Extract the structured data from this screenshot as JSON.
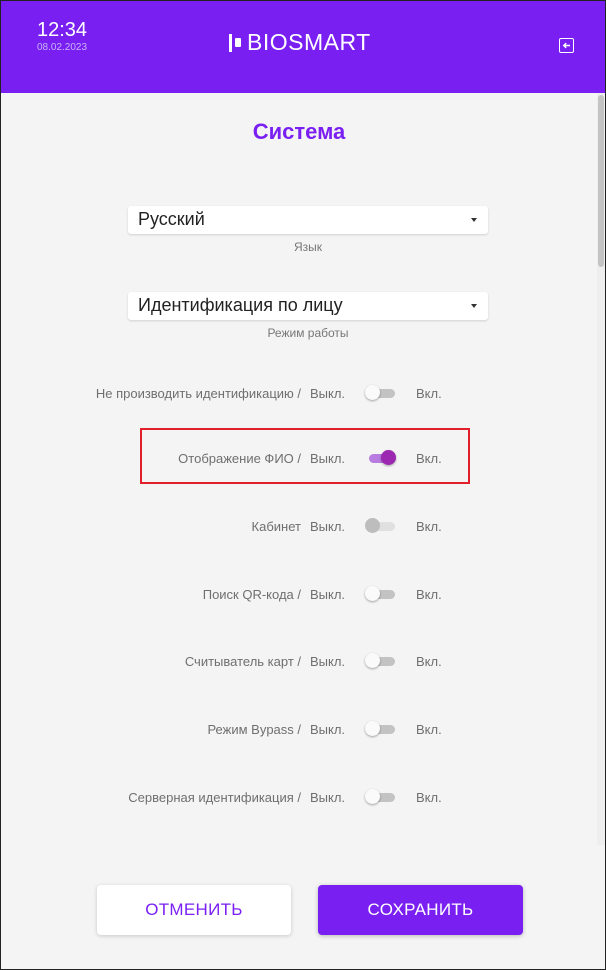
{
  "header": {
    "time": "12:34",
    "date": "08.02.2023",
    "brand": "BIOSMART",
    "exit_icon": "exit-icon"
  },
  "colors": {
    "primary": "#7a1ff2",
    "toggle_on": "#9c27b0",
    "highlight": "#e0202a"
  },
  "page": {
    "title": "Система"
  },
  "language": {
    "value": "Русский",
    "helper": "Язык"
  },
  "mode": {
    "value": "Идентификация по лицу",
    "helper": "Режим работы"
  },
  "settings": [
    {
      "label": "Не производить идентификацию /",
      "off": "Выкл.",
      "on": "Вкл.",
      "checked": false,
      "disabled": false
    },
    {
      "label": "Отображение ФИО /",
      "off": "Выкл.",
      "on": "Вкл.",
      "checked": true,
      "disabled": false
    },
    {
      "label": "Кабинет",
      "off": "Выкл.",
      "on": "Вкл.",
      "checked": false,
      "disabled": true
    },
    {
      "label": "Поиск QR-кода /",
      "off": "Выкл.",
      "on": "Вкл.",
      "checked": false,
      "disabled": false
    },
    {
      "label": "Считыватель карт /",
      "off": "Выкл.",
      "on": "Вкл.",
      "checked": false,
      "disabled": false
    },
    {
      "label": "Режим Bypass /",
      "off": "Выкл.",
      "on": "Вкл.",
      "checked": false,
      "disabled": false
    },
    {
      "label": "Серверная идентификация /",
      "off": "Выкл.",
      "on": "Вкл.",
      "checked": false,
      "disabled": false
    }
  ],
  "actions": {
    "cancel": "ОТМЕНИТЬ",
    "save": "СОХРАНИТЬ"
  }
}
